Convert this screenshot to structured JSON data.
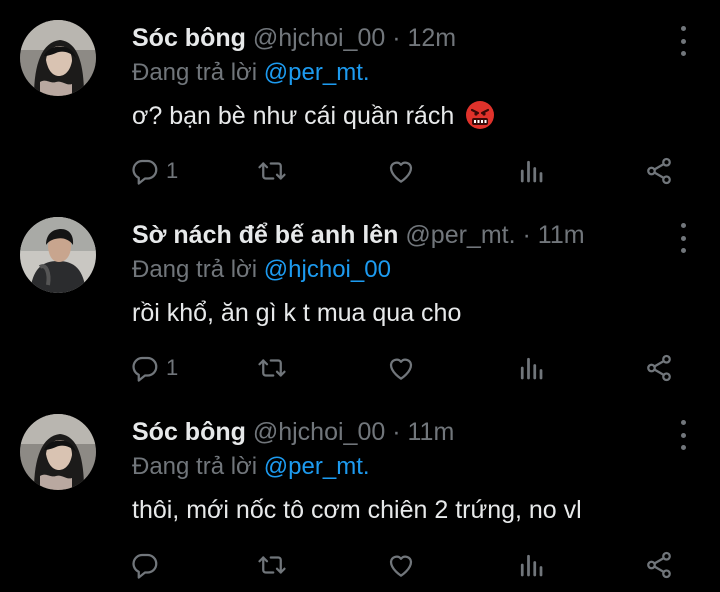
{
  "colors": {
    "background": "#000000",
    "text_primary": "#e7e9ea",
    "text_secondary": "#71767b",
    "accent": "#1d9bf0"
  },
  "tweets": [
    {
      "display_name": "Sóc bông",
      "handle": "@hjchoi_00",
      "separator": "·",
      "time": "12m",
      "reply_prefix": "Đang trả lời",
      "reply_to": "@per_mt.",
      "text": "ơ? bạn bè như cái quần rách",
      "emoji": "face-with-symbols-on-mouth",
      "reply_count": "1",
      "retweet_count": "",
      "like_count": "",
      "icons": [
        "reply-icon",
        "retweet-icon",
        "like-icon",
        "analytics-icon",
        "share-icon",
        "more-icon"
      ]
    },
    {
      "display_name": "Sờ nách để bế anh lên",
      "handle": "@per_mt.",
      "separator": "·",
      "time": "11m",
      "reply_prefix": "Đang trả lời",
      "reply_to": "@hjchoi_00",
      "text": "rồi khổ, ăn gì k t mua qua cho",
      "emoji": "",
      "reply_count": "1",
      "retweet_count": "",
      "like_count": "",
      "icons": [
        "reply-icon",
        "retweet-icon",
        "like-icon",
        "analytics-icon",
        "share-icon",
        "more-icon"
      ]
    },
    {
      "display_name": "Sóc bông",
      "handle": "@hjchoi_00",
      "separator": "·",
      "time": "11m",
      "reply_prefix": "Đang trả lời",
      "reply_to": "@per_mt.",
      "text": "thôi, mới nốc tô cơm chiên 2 trứng, no vl",
      "emoji": "",
      "reply_count": "",
      "retweet_count": "",
      "like_count": "",
      "icons": [
        "reply-icon",
        "retweet-icon",
        "like-icon",
        "analytics-icon",
        "share-icon",
        "more-icon"
      ]
    }
  ]
}
